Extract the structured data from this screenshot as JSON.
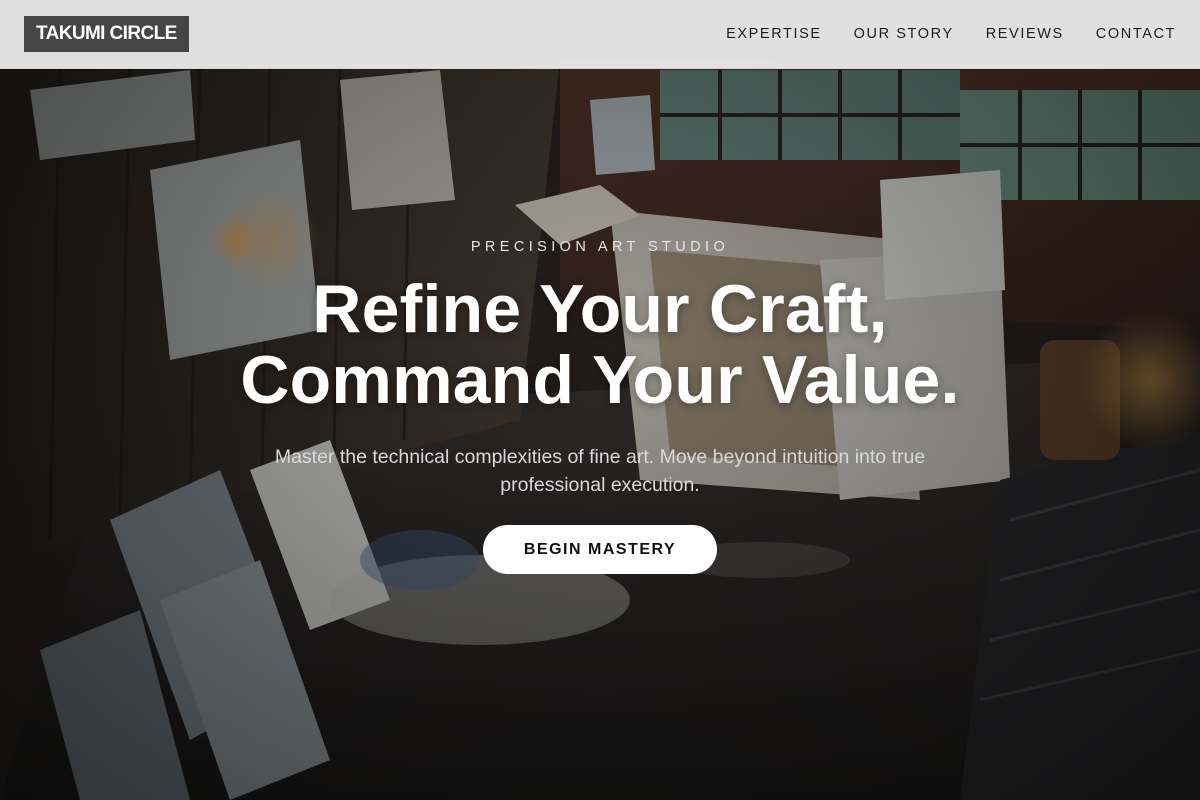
{
  "header": {
    "logo": "TAKUMI CIRCLE",
    "nav": [
      {
        "label": "EXPERTISE"
      },
      {
        "label": "OUR STORY"
      },
      {
        "label": "REVIEWS"
      },
      {
        "label": "CONTACT"
      }
    ]
  },
  "hero": {
    "eyebrow": "PRECISION ART STUDIO",
    "headline_line1": "Refine Your Craft,",
    "headline_line2": "Command Your Value.",
    "subtext": "Master the technical complexities of fine art. Move beyond intuition into true professional execution.",
    "cta_label": "BEGIN MASTERY"
  },
  "colors": {
    "header_bg": "#f0f0f0",
    "logo_bg": "#454545",
    "cta_bg": "#ffffff",
    "hero_text": "#ffffff"
  }
}
